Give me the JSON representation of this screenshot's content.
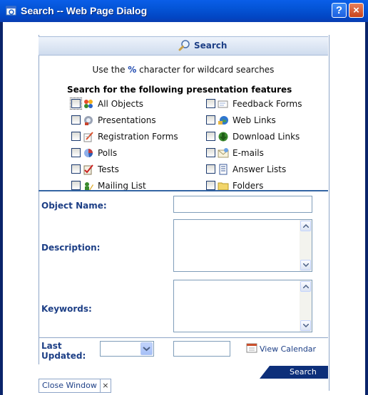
{
  "window": {
    "title": "Search -- Web Page Dialog",
    "help_button": "?",
    "close_button": "×"
  },
  "header": {
    "label": "Search"
  },
  "help_text": {
    "before": "Use the ",
    "wildcard": "%",
    "after": " character for wildcard searches"
  },
  "features": {
    "heading": "Search for the following presentation features",
    "left": [
      {
        "label": "All Objects",
        "icon": "all-objects-icon"
      },
      {
        "label": "Presentations",
        "icon": "presentations-icon"
      },
      {
        "label": "Registration Forms",
        "icon": "registration-forms-icon"
      },
      {
        "label": "Polls",
        "icon": "polls-icon"
      },
      {
        "label": "Tests",
        "icon": "tests-icon"
      },
      {
        "label": "Mailing List",
        "icon": "mailing-list-icon"
      }
    ],
    "right": [
      {
        "label": "Feedback Forms",
        "icon": "feedback-forms-icon"
      },
      {
        "label": "Web Links",
        "icon": "web-links-icon"
      },
      {
        "label": "Download Links",
        "icon": "download-links-icon"
      },
      {
        "label": "E-mails",
        "icon": "emails-icon"
      },
      {
        "label": "Answer Lists",
        "icon": "answer-lists-icon"
      },
      {
        "label": "Folders",
        "icon": "folders-icon"
      }
    ]
  },
  "form": {
    "object_name_label": "Object Name:",
    "object_name_value": "",
    "description_label": "Description:",
    "description_value": "",
    "keywords_label": "Keywords:",
    "keywords_value": "",
    "last_updated_label_1": "Last",
    "last_updated_label_2": "Updated:",
    "last_updated_select": "",
    "last_updated_date": "",
    "view_calendar": "View Calendar"
  },
  "search_button": "Search",
  "close_window": {
    "label": "Close Window",
    "x": "×"
  },
  "colors": {
    "title_bar": "#0454d6",
    "label_blue": "#1d3f86",
    "divider": "#3465a4",
    "search_tab": "#0d2f7a"
  }
}
